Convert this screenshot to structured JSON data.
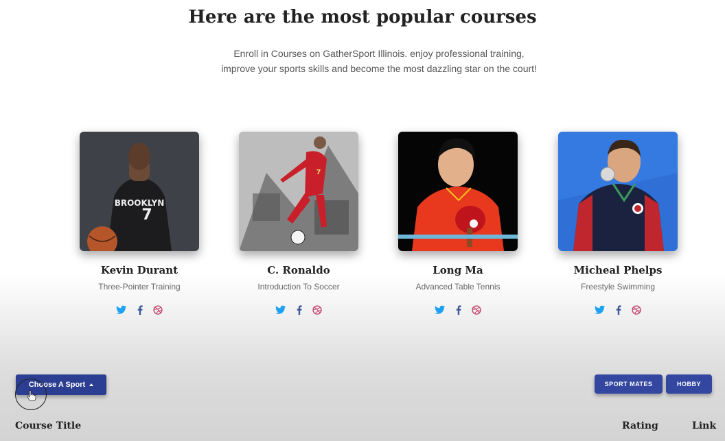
{
  "header": {
    "title": "Here are the most popular courses",
    "subtitle_line1": "Enroll in Courses on GatherSport Illinois. enjoy professional training,",
    "subtitle_line2": "improve your sports skills and become the most dazzling star on the court!"
  },
  "instructors": [
    {
      "name": "Kevin Durant",
      "course": "Three-Pointer Training",
      "jersey": "BROOKLYN",
      "number": "7"
    },
    {
      "name": "C. Ronaldo",
      "course": "Introduction To Soccer",
      "number": "7"
    },
    {
      "name": "Long Ma",
      "course": "Advanced Table Tennis"
    },
    {
      "name": "Micheal Phelps",
      "course": "Freestyle Swimming"
    }
  ],
  "social_icons": [
    "twitter-icon",
    "facebook-icon",
    "dribbble-icon"
  ],
  "colors": {
    "twitter": "#1da1f2",
    "facebook": "#3b5998",
    "dribbble": "#c4466d",
    "primary_button": "#2c3e91"
  },
  "controls": {
    "choose_sport": "Choose A Sport",
    "sport_mates": "SPORT MATES",
    "hobby": "HOBBY"
  },
  "table": {
    "col_course_title": "Course Title",
    "col_rating": "Rating",
    "col_link": "Link"
  }
}
